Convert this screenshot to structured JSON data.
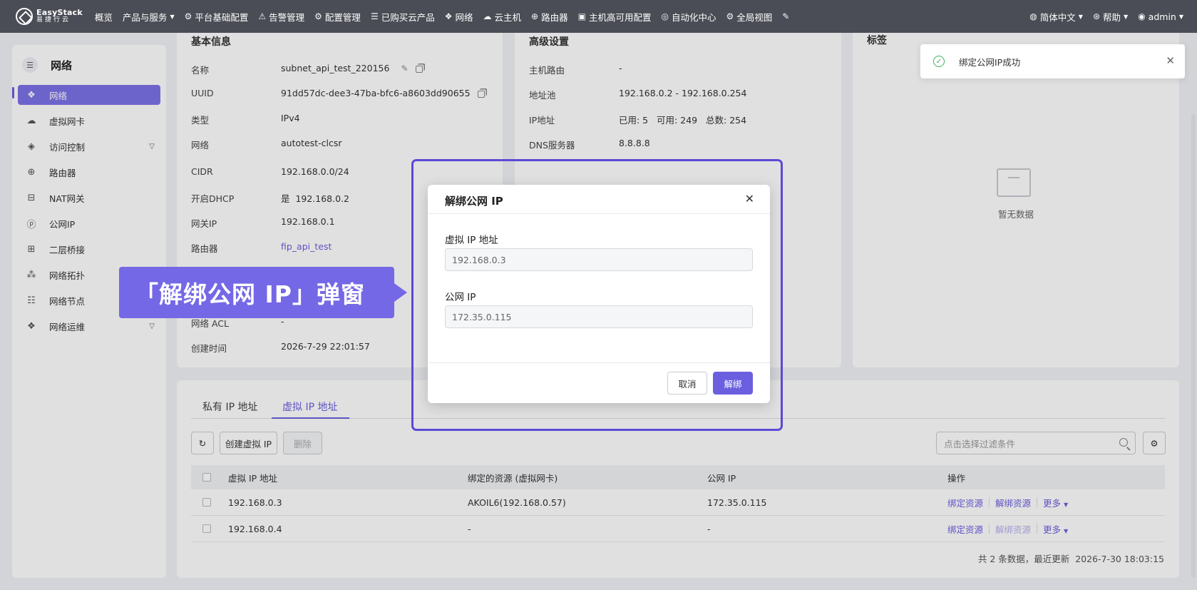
{
  "nav": {
    "logo_line1": "EasyStack",
    "logo_line2": "易捷行云",
    "items": [
      {
        "label": "概览"
      },
      {
        "label": "产品与服务"
      },
      {
        "label": "平台基础配置"
      },
      {
        "label": "告警管理"
      },
      {
        "label": "配置管理"
      },
      {
        "label": "已购买云产品"
      },
      {
        "label": "网络"
      },
      {
        "label": "云主机"
      },
      {
        "label": "路由器"
      },
      {
        "label": "主机高可用配置"
      },
      {
        "label": "自动化中心"
      },
      {
        "label": "全局视图"
      }
    ],
    "lang": "简体中文",
    "help": "帮助",
    "user": "admin"
  },
  "sidebar": {
    "title": "网络",
    "items": [
      {
        "label": "网络"
      },
      {
        "label": "虚拟网卡"
      },
      {
        "label": "访问控制"
      },
      {
        "label": "路由器"
      },
      {
        "label": "NAT网关"
      },
      {
        "label": "公网IP"
      },
      {
        "label": "二层桥接"
      },
      {
        "label": "网络拓扑"
      },
      {
        "label": "网络节点"
      },
      {
        "label": "网络运维"
      }
    ]
  },
  "basic": {
    "title": "基本信息",
    "rows": [
      {
        "label": "名称",
        "value": "subnet_api_test_220156"
      },
      {
        "label": "UUID",
        "value": "91dd57dc-dee3-47ba-bfc6-a8603dd90655"
      },
      {
        "label": "类型",
        "value": "IPv4"
      },
      {
        "label": "网络",
        "value": "autotest-clcsr"
      },
      {
        "label": "CIDR",
        "value": "192.168.0.0/24"
      },
      {
        "label": "开启DHCP",
        "value": "是  192.168.0.2"
      },
      {
        "label": "网关IP",
        "value": "192.168.0.1"
      },
      {
        "label": "路由器",
        "value": "fip_api_test"
      },
      {
        "label": "网络 ACL",
        "value": "-"
      },
      {
        "label": "创建时间",
        "value": "2026-7-29 22:01:57"
      }
    ]
  },
  "advanced": {
    "title": "高级设置",
    "rows": [
      {
        "label": "主机路由",
        "value": "-"
      },
      {
        "label": "地址池",
        "value": "192.168.0.2 - 192.168.0.254"
      },
      {
        "label": "IP地址",
        "value": "已用: 5   可用: 249   总数: 254"
      },
      {
        "label": "DNS服务器",
        "value": "8.8.8.8"
      }
    ]
  },
  "tags": {
    "title": "标签",
    "empty": "暂无数据"
  },
  "tabs": {
    "private": "私有 IP 地址",
    "virtual": "虚拟 IP 地址"
  },
  "toolbar": {
    "create": "创建虚拟 IP",
    "delete": "删除",
    "filter_placeholder": "点击选择过滤条件"
  },
  "table": {
    "headers": [
      "虚拟 IP 地址",
      "绑定的资源 (虚拟网卡)",
      "公网 IP",
      "操作"
    ],
    "rows": [
      {
        "ip": "192.168.0.3",
        "resource": "AKOIL6(192.168.0.57)",
        "fip": "172.35.0.115"
      },
      {
        "ip": "192.168.0.4",
        "resource": "-",
        "fip": "-"
      }
    ],
    "action_bind": "绑定资源",
    "action_unbind": "解绑资源",
    "action_more": "更多",
    "footer": "共 2 条数据，最近更新  2026-7-30 18:03:15"
  },
  "modal": {
    "title": "解绑公网 IP",
    "vip_label": "虚拟 IP 地址",
    "vip_value": "192.168.0.3",
    "fip_label": "公网 IP",
    "fip_value": "172.35.0.115",
    "cancel": "取消",
    "confirm": "解绑"
  },
  "callout": "「解绑公网 IP」弹窗",
  "toast": "绑定公网IP成功",
  "colors": {
    "accent": "#6b5fe0",
    "nav_bg": "#4a4d55",
    "success": "#3fb05a",
    "highlight": "#5b49d6"
  }
}
